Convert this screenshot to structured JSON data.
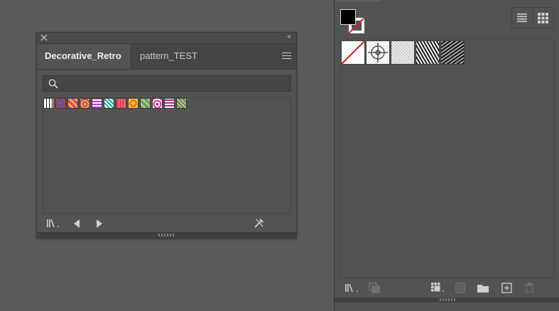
{
  "library_panel": {
    "tabs": [
      {
        "label": "Decorative_Retro",
        "active": true
      },
      {
        "label": "pattern_TEST",
        "active": false
      }
    ],
    "search": {
      "placeholder": "",
      "value": ""
    },
    "mini_swatches": [
      {
        "name": "swatch-1",
        "colors": [
          "#ffffff",
          "#222222"
        ]
      },
      {
        "name": "swatch-2",
        "colors": [
          "#2b63c6",
          "#e23a2a"
        ]
      },
      {
        "name": "swatch-3",
        "colors": [
          "#e8369a",
          "#f0c020"
        ]
      },
      {
        "name": "swatch-4",
        "colors": [
          "#f2b01e",
          "#c43a9a"
        ]
      },
      {
        "name": "swatch-5",
        "colors": [
          "#b03ad8",
          "#ffffff"
        ]
      },
      {
        "name": "swatch-6",
        "colors": [
          "#1ca78f",
          "#ffffff"
        ]
      },
      {
        "name": "swatch-7",
        "colors": [
          "#e63d7a",
          "#ff9b2b"
        ]
      },
      {
        "name": "swatch-8",
        "colors": [
          "#f07a1e",
          "#ffcc3a"
        ]
      },
      {
        "name": "swatch-9",
        "colors": [
          "#2bb0a0",
          "#f2b52a"
        ]
      },
      {
        "name": "swatch-10",
        "colors": [
          "#e5318f",
          "#ffffff"
        ]
      },
      {
        "name": "swatch-11",
        "colors": [
          "#ffffff",
          "#c2228e"
        ]
      },
      {
        "name": "swatch-12",
        "colors": [
          "#f2c31a",
          "#2f83d6"
        ]
      }
    ]
  },
  "swatches_panel": {
    "fill_color": "#000000",
    "stroke_color": "#ffffff",
    "swatches": [
      {
        "name": "none-swatch"
      },
      {
        "name": "registration-swatch"
      },
      {
        "name": "pattern-swatch-fine"
      },
      {
        "name": "pattern-swatch-mosaic"
      },
      {
        "name": "pattern-swatch-dark"
      }
    ]
  }
}
